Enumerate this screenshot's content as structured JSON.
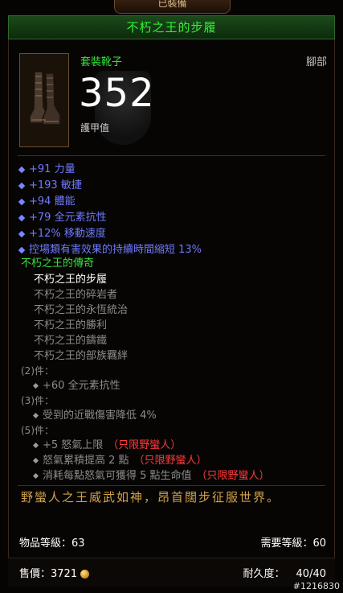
{
  "header": {
    "tab_label": "已裝備",
    "item_name": "不朽之王的步履"
  },
  "item": {
    "type": "套裝靴子",
    "slot": "腳部",
    "armor_value": "352",
    "armor_label": "護甲值",
    "icon": "boots-icon"
  },
  "affixes": [
    "+91 力量",
    "+193 敏捷",
    "+94 體能",
    "+79 全元素抗性",
    "+12% 移動速度",
    "控場類有害效果的持續時間縮短 13%"
  ],
  "set": {
    "name": "不朽之王的傳奇",
    "pieces": [
      {
        "label": "不朽之王的步履",
        "owned": true
      },
      {
        "label": "不朽之王的碎岩者",
        "owned": false
      },
      {
        "label": "不朽之王的永恆統治",
        "owned": false
      },
      {
        "label": "不朽之王的勝利",
        "owned": false
      },
      {
        "label": "不朽之王的鑄鐵",
        "owned": false
      },
      {
        "label": "不朽之王的部族羈絆",
        "owned": false
      }
    ],
    "bonuses": [
      {
        "header": "(2)件：",
        "lines": [
          {
            "text": "+60 全元素抗性",
            "restriction": ""
          }
        ]
      },
      {
        "header": "(3)件：",
        "lines": [
          {
            "text": "受到的近戰傷害降低 4%",
            "restriction": ""
          }
        ]
      },
      {
        "header": "(5)件：",
        "lines": [
          {
            "text": "+5 怒氣上限",
            "restriction": "（只限野蠻人）"
          },
          {
            "text": "怒氣累積提高 2 點",
            "restriction": "（只限野蠻人）"
          },
          {
            "text": "消耗每點怒氣可獲得 5 點生命值",
            "restriction": "（只限野蠻人）"
          }
        ]
      }
    ]
  },
  "flavor_text": "野蠻人之王威武如神，昂首闊步征服世界。",
  "meta": {
    "item_level_label": "物品等級：63",
    "required_level_label": "需要等級：60",
    "sell_label": "售價：3721",
    "durability_label": "耐久度：",
    "durability_value": "40/40"
  },
  "watermark": "#1216830",
  "colors": {
    "set_green": "#35e23c",
    "affix_blue": "#6f79ff",
    "restriction_red": "#ff3b3b",
    "flavor_gold": "#d2a24a"
  }
}
